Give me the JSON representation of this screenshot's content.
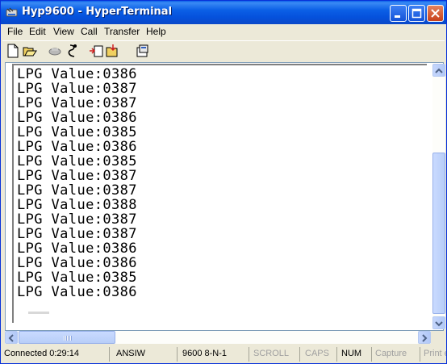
{
  "window": {
    "title": "Hyp9600 - HyperTerminal"
  },
  "menubar": {
    "items": [
      "File",
      "Edit",
      "View",
      "Call",
      "Transfer",
      "Help"
    ]
  },
  "toolbar": {
    "icons": [
      "new-icon",
      "open-icon",
      "disconnect-icon",
      "hangup-icon",
      "send-icon",
      "receive-icon",
      "properties-icon"
    ]
  },
  "terminal": {
    "lines": [
      "LPG Value:0386",
      "LPG Value:0387",
      "LPG Value:0387",
      "LPG Value:0386",
      "LPG Value:0385",
      "LPG Value:0386",
      "LPG Value:0385",
      "LPG Value:0387",
      "LPG Value:0387",
      "LPG Value:0388",
      "LPG Value:0387",
      "LPG Value:0387",
      "LPG Value:0386",
      "LPG Value:0386",
      "LPG Value:0385",
      "LPG Value:0386"
    ]
  },
  "statusbar": {
    "connected": "Connected 0:29:14",
    "emulation": "ANSIW",
    "settings": "9600 8-N-1",
    "scroll": "SCROLL",
    "caps": "CAPS",
    "num": "NUM",
    "capture": "Capture",
    "print": "Print echo"
  }
}
